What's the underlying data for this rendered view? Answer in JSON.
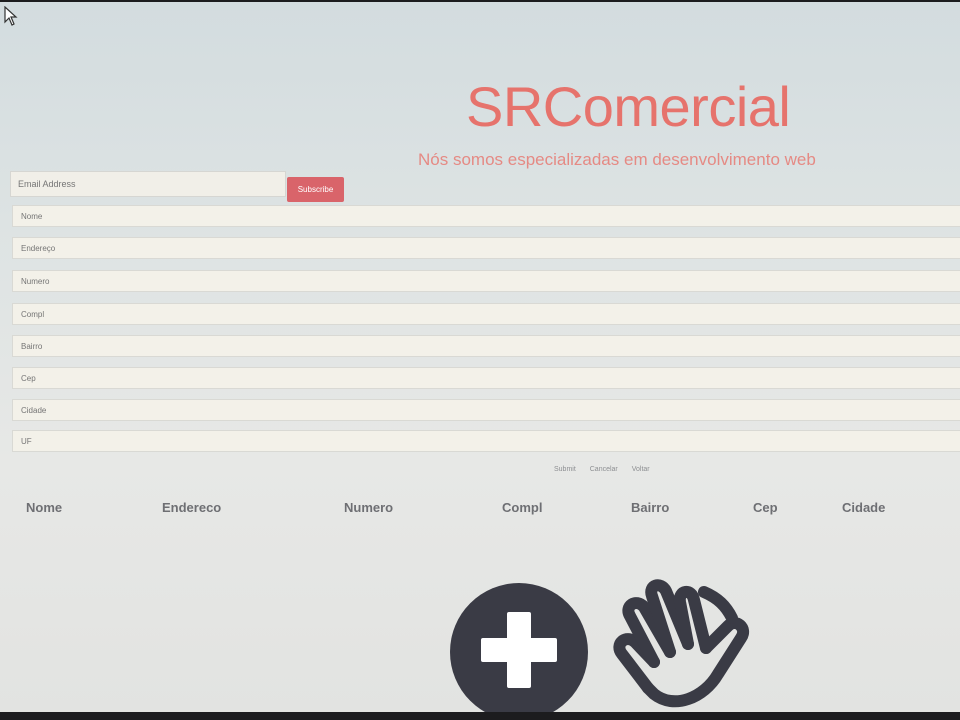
{
  "brand": {
    "title": "SRComercial",
    "tagline": "Nós somos especializadas em desenvolvimento web"
  },
  "newsletter": {
    "email_placeholder": "Email Address",
    "subscribe_label": "Subscribe",
    "button_color": "#d9646a"
  },
  "form": {
    "fields": [
      {
        "placeholder": "Nome"
      },
      {
        "placeholder": "Endereço"
      },
      {
        "placeholder": "Numero"
      },
      {
        "placeholder": "Compl"
      },
      {
        "placeholder": "Bairro"
      },
      {
        "placeholder": "Cep"
      },
      {
        "placeholder": "Cidade"
      },
      {
        "placeholder": "UF"
      }
    ],
    "actions": {
      "submit": "Submit",
      "cancel": "Cancelar",
      "back": "Voltar"
    }
  },
  "table": {
    "headers": [
      "Nome",
      "Endereco",
      "Numero",
      "Compl",
      "Bairro",
      "Cep",
      "Cidade"
    ]
  },
  "icons": {
    "add": "plus-circle-icon",
    "wave": "waving-hand-icon",
    "cursor": "mouse-pointer-icon"
  },
  "colors": {
    "brand": "#e6736c",
    "icon_dark": "#3a3b45"
  }
}
